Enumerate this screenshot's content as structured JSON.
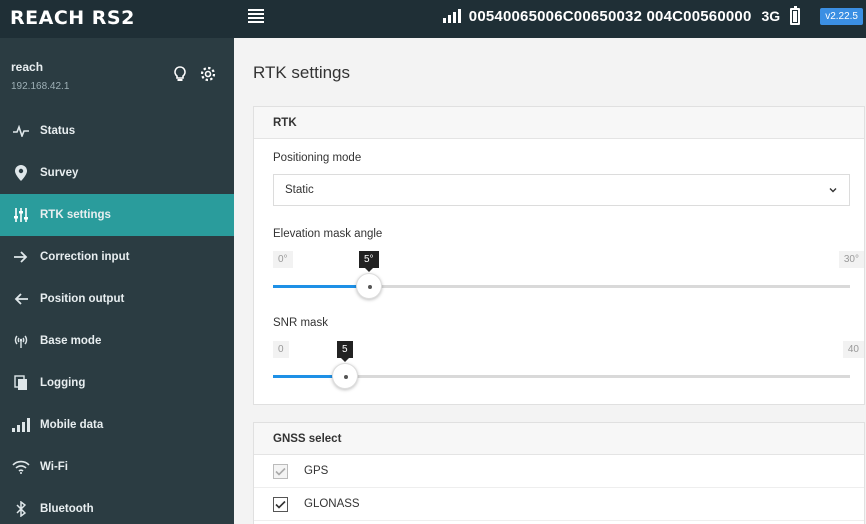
{
  "header": {
    "brand": "REACH RS2",
    "serial": "00540065006C00650032 004C00560000",
    "network": "3G",
    "version": "v2.22.5"
  },
  "sidebar": {
    "device_name": "reach",
    "device_ip": "192.168.42.1",
    "items": [
      {
        "label": "Status",
        "icon": "activity-icon"
      },
      {
        "label": "Survey",
        "icon": "location-pin-icon"
      },
      {
        "label": "RTK settings",
        "icon": "sliders-icon",
        "active": true
      },
      {
        "label": "Correction input",
        "icon": "arrow-right-icon"
      },
      {
        "label": "Position output",
        "icon": "arrow-left-icon"
      },
      {
        "label": "Base mode",
        "icon": "antenna-icon"
      },
      {
        "label": "Logging",
        "icon": "files-icon"
      },
      {
        "label": "Mobile data",
        "icon": "signal-bars-icon"
      },
      {
        "label": "Wi-Fi",
        "icon": "wifi-icon"
      },
      {
        "label": "Bluetooth",
        "icon": "bluetooth-icon"
      }
    ]
  },
  "main": {
    "title": "RTK settings",
    "rtk": {
      "heading": "RTK",
      "positioning_label": "Positioning mode",
      "positioning_value": "Static",
      "elevation": {
        "label": "Elevation mask angle",
        "min": "0°",
        "max": "30°",
        "value_label": "5°",
        "value": 5,
        "range": [
          0,
          30
        ]
      },
      "snr": {
        "label": "SNR mask",
        "min": "0",
        "max": "40",
        "value_label": "5",
        "value": 5,
        "range": [
          0,
          40
        ]
      }
    },
    "gnss": {
      "heading": "GNSS select",
      "items": [
        {
          "label": "GPS",
          "checked": true,
          "disabled": true
        },
        {
          "label": "GLONASS",
          "checked": true,
          "disabled": false
        }
      ]
    }
  },
  "colors": {
    "header_bg": "#1f2f36",
    "sidebar_bg": "#2b3c42",
    "active_item": "#2a9c9c",
    "slider_fill": "#1e90e6",
    "version_badge": "#3b8fe3"
  }
}
